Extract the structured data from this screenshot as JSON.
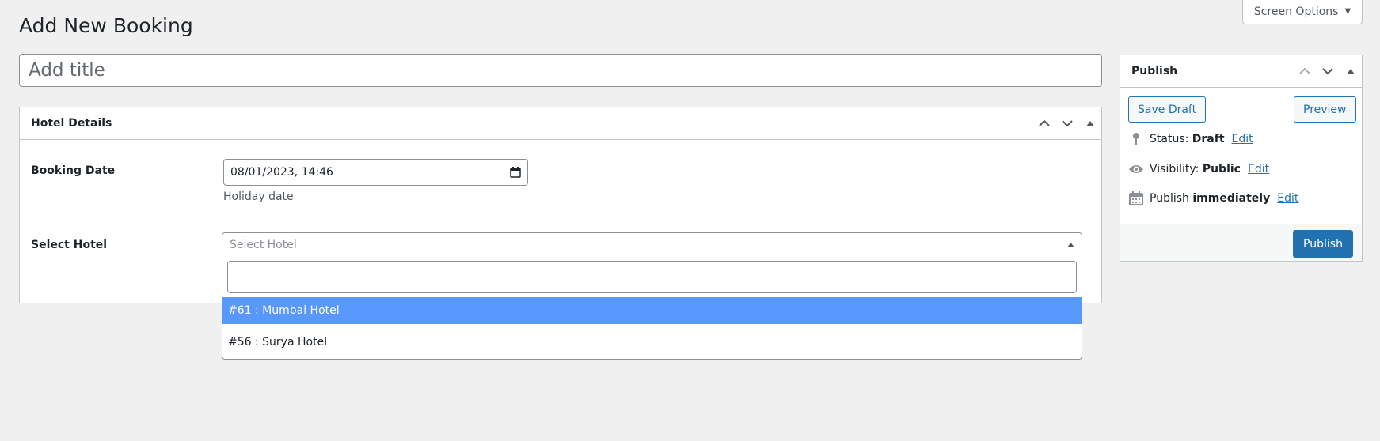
{
  "screen_options": {
    "label": "Screen Options",
    "arrow": "▼"
  },
  "page_title": "Add New Booking",
  "title_field": {
    "placeholder": "Add title",
    "value": ""
  },
  "hotel_details": {
    "title": "Hotel Details",
    "booking_date": {
      "label": "Booking Date",
      "value": "08/01/2023, 14:46",
      "description": "Holiday date"
    },
    "select_hotel": {
      "label": "Select Hotel",
      "placeholder": "Select Hotel",
      "search_value": "",
      "options": [
        {
          "label": "#61 : Mumbai Hotel",
          "highlighted": true
        },
        {
          "label": "#56 : Surya Hotel",
          "highlighted": false
        }
      ]
    }
  },
  "publish": {
    "title": "Publish",
    "save_draft": "Save Draft",
    "preview": "Preview",
    "status": {
      "label": "Status:",
      "value": "Draft",
      "edit": "Edit"
    },
    "visibility": {
      "label": "Visibility:",
      "value": "Public",
      "edit": "Edit"
    },
    "schedule": {
      "label": "Publish",
      "value": "immediately",
      "edit": "Edit"
    },
    "publish_button": "Publish"
  },
  "colors": {
    "accent": "#2271b1",
    "highlight": "#5897fb",
    "background": "#f0f0f1"
  },
  "icons": [
    "chevron-up-icon",
    "chevron-down-icon",
    "toggle-triangle-icon",
    "calendar-icon",
    "pin-icon",
    "eye-icon",
    "calendar-grid-icon"
  ]
}
